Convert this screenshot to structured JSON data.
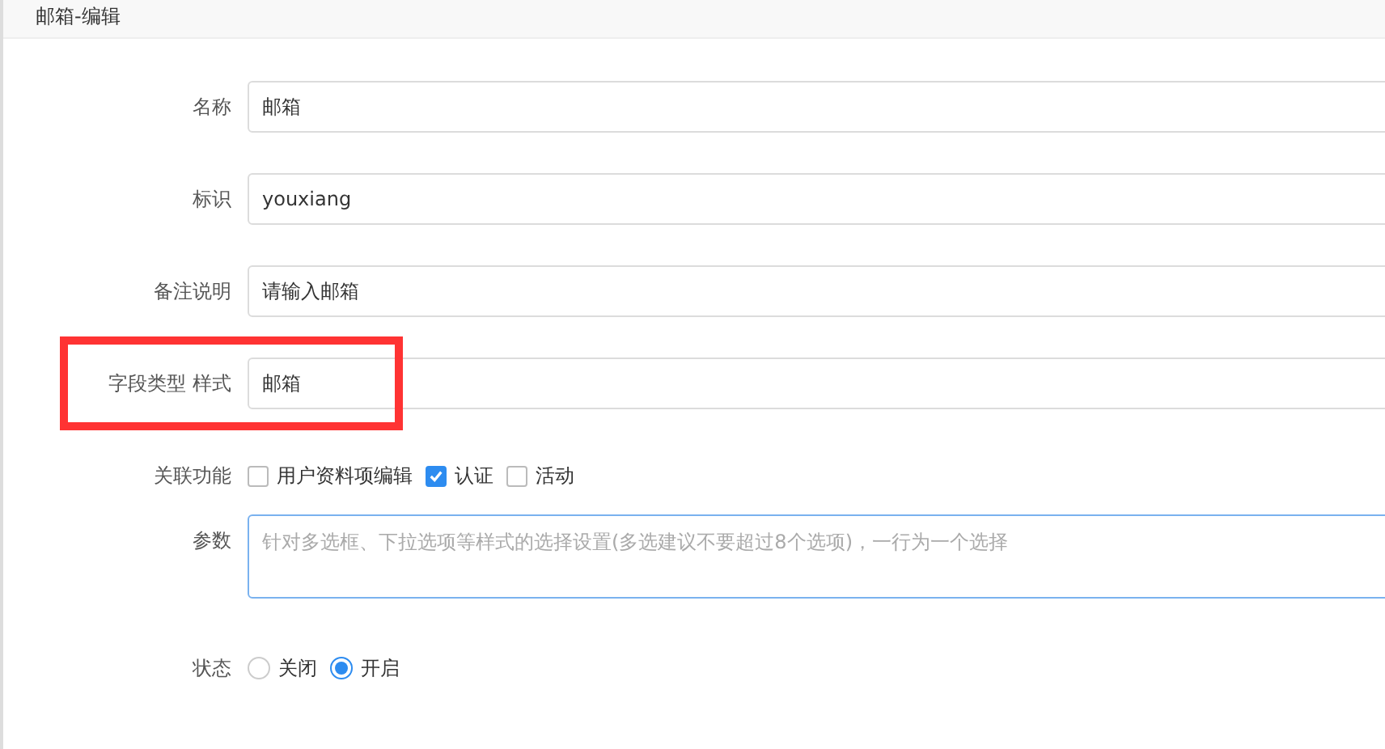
{
  "dialog": {
    "title": "邮箱-编辑"
  },
  "fields": [
    {
      "kind": "text",
      "label": "名称",
      "value": "邮箱",
      "highlighted": false
    },
    {
      "kind": "text",
      "label": "标识",
      "value": "youxiang",
      "highlighted": false
    },
    {
      "kind": "text",
      "label": "备注说明",
      "value": "请输入邮箱",
      "highlighted": false
    },
    {
      "kind": "text",
      "label": "字段类型 样式",
      "value": "邮箱",
      "highlighted": true
    },
    {
      "kind": "checkboxes",
      "label": "关联功能",
      "options": [
        {
          "label": "用户资料项编辑",
          "checked": false
        },
        {
          "label": "认证",
          "checked": true
        },
        {
          "label": "活动",
          "checked": false
        }
      ]
    },
    {
      "kind": "textarea",
      "label": "参数",
      "placeholder": "针对多选框、下拉选项等样式的选择设置(多选建议不要超过8个选项)，一行为一个选择",
      "focused": true
    },
    {
      "kind": "radios",
      "label": "状态",
      "options": [
        {
          "label": "关闭",
          "selected": false
        },
        {
          "label": "开启",
          "selected": true
        }
      ]
    }
  ]
}
